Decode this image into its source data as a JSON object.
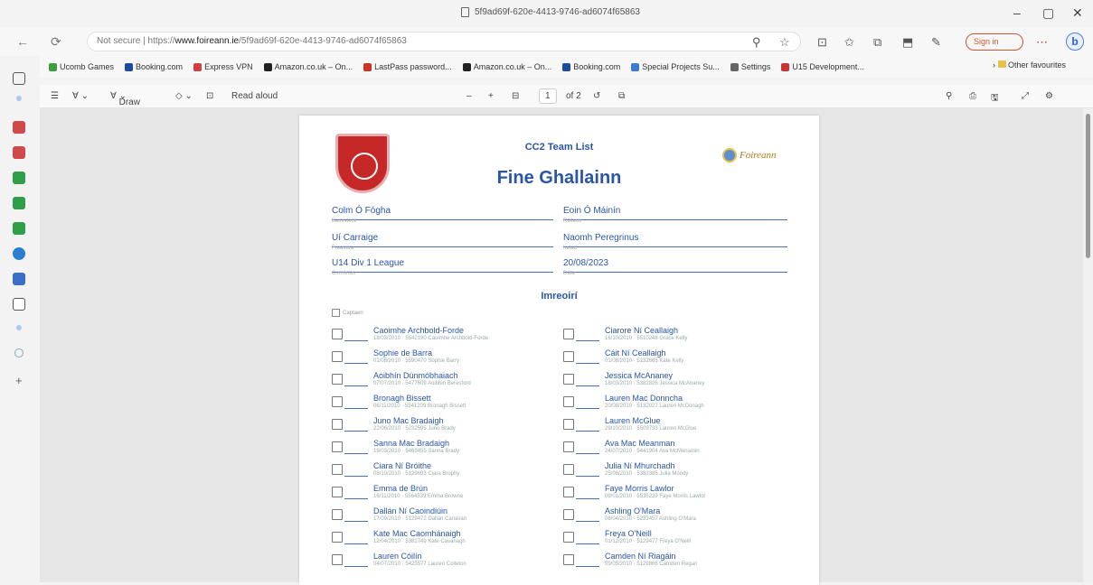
{
  "window": {
    "tab_title": "5f9ad69f-620e-4413-9746-ad6074f65863",
    "minimize": "–",
    "maximize": "▢",
    "close": "✕"
  },
  "address": {
    "url_prefix": "Not secure | https://",
    "url_host": "www.foireann.ie",
    "url_path": "/5f9ad69f-620e-4413-9746-ad6074f65863",
    "sign_in": "Sign in",
    "bing": "b"
  },
  "favourites": [
    {
      "label": "Ucomb Games",
      "color": "#3a9e3a"
    },
    {
      "label": "Booking.com",
      "color": "#1b4aa0"
    },
    {
      "label": "Express VPN",
      "color": "#d04040"
    },
    {
      "label": "Amazon.co.uk – On...",
      "color": "#222"
    },
    {
      "label": "LastPass password...",
      "color": "#c32"
    },
    {
      "label": "Amazon.co.uk – On...",
      "color": "#222"
    },
    {
      "label": "Booking.com",
      "color": "#1b4aa0"
    },
    {
      "label": "Special Projects Su...",
      "color": "#3a7bd5"
    },
    {
      "label": "Settings",
      "color": "#666"
    },
    {
      "label": "U15 Development...",
      "color": "#c33"
    }
  ],
  "favourites_more": "Other favourites",
  "pdf_toolbar": {
    "draw": "Draw",
    "read_aloud": "Read aloud",
    "zoom_out": "–",
    "zoom_in": "+",
    "page_current": "1",
    "page_total": "of 2"
  },
  "document": {
    "subtitle": "CC2 Team List",
    "title": "Fine Ghallainn",
    "logo_text": "Foireann",
    "fields": {
      "coach": {
        "value": "Colm Ó Fógha",
        "label": "Bainisteoir"
      },
      "referee": {
        "value": "Eoin Ó Máinín",
        "label": "Réiteoir"
      },
      "opponent": {
        "value": "Uí Carraige",
        "label": "Freasúra"
      },
      "venue": {
        "value": "Naomh Peregrinus",
        "label": "Ionad"
      },
      "competition": {
        "value": "U14 Div 1 League",
        "label": "Comórtas"
      },
      "date": {
        "value": "20/08/2023",
        "label": "Dáta"
      }
    },
    "section_title": "Imreoirí",
    "captain_label": "Captaen",
    "players_left": [
      {
        "name": "Caoimhe Archbold-Forde",
        "info": "18/03/2010 · 5542190 Caoimhe Archbold-Forde"
      },
      {
        "name": "Sophie de Barra",
        "info": "01/08/2010 · 5590470 Sophie Barry"
      },
      {
        "name": "Aoibhín Dúnmóbhaiach",
        "info": "07/07/2010 · 5477609 Aoibhin Beresford"
      },
      {
        "name": "Bronagh Bissett",
        "info": "06/11/2010 · 5541209 Bronagh Bissett"
      },
      {
        "name": "Juno Mac Bradaigh",
        "info": "22/06/2010 · 5232595 Juno Brady"
      },
      {
        "name": "Sanna Mac Bradaigh",
        "info": "19/03/2010 · 5469455 Sanna Brady"
      },
      {
        "name": "Ciara Ní Bróithe",
        "info": "08/10/2010 · 5129693 Ciara Brophy"
      },
      {
        "name": "Emma de Brún",
        "info": "16/11/2010 · 5564539 Emma Browne"
      },
      {
        "name": "Dallán Ní Caoindiúin",
        "info": "17/09/2010 · 5129472 Dallán Canavan"
      },
      {
        "name": "Kate Mac Caomhánaigh",
        "info": "12/04/2010 · 5382749 Kate Cavanagh"
      },
      {
        "name": "Lauren Cóilín",
        "info": "04/07/2010 · 5425577 Lauren Colleton"
      }
    ],
    "players_right": [
      {
        "name": "Ciarore Ní Ceallaigh",
        "info": "16/10/2010 · 5510248 Grace Kelly"
      },
      {
        "name": "Cáit Ní Ceallaigh",
        "info": "01/08/2010 · 5132665 Kate Kelly"
      },
      {
        "name": "Jessica McAnaney",
        "info": "18/03/2010 · 5382826 Jessica McAnaney"
      },
      {
        "name": "Lauren Mac Donncha",
        "info": "20/08/2010 · 5132027 Lauren McDonagh"
      },
      {
        "name": "Lauren McGlue",
        "info": "29/10/2010 · 5509733 Lauren McGlue"
      },
      {
        "name": "Ava Mac Meanman",
        "info": "24/07/2010 · 5441904 Ava McMenamin"
      },
      {
        "name": "Julia Ní Mhurchadh",
        "info": "25/08/2010 · 5382385 Julia Moody"
      },
      {
        "name": "Faye Morris Lawlor",
        "info": "09/01/2010 · 5535239 Faye Morris Lawlor"
      },
      {
        "name": "Ashling O'Mara",
        "info": "08/04/2010 · 5233457 Ashling O'Mara"
      },
      {
        "name": "Freya O'Neill",
        "info": "01/12/2010 · 5129477 Freya O'Neill"
      },
      {
        "name": "Camden Ní Riagáin",
        "info": "09/05/2010 · 5129866 Camden Regan"
      }
    ]
  },
  "colors": {
    "accent": "#2a55a8",
    "crest": "#c62828",
    "signin": "#cc5533"
  }
}
